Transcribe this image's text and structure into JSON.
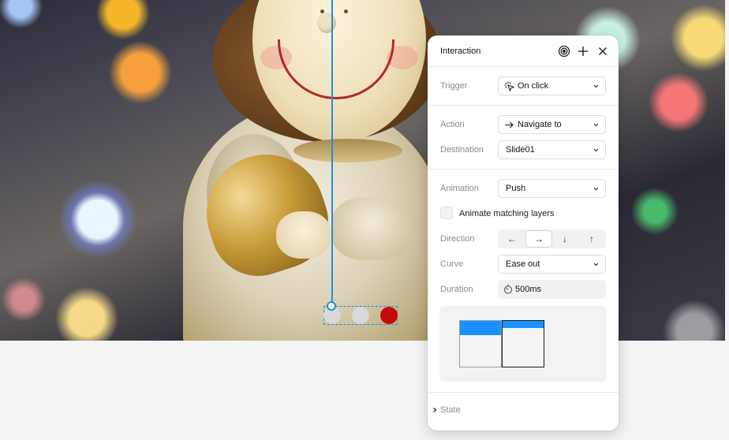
{
  "panel": {
    "title": "Interaction",
    "header_icons": [
      "target-icon",
      "plus-icon",
      "close-icon"
    ]
  },
  "trigger": {
    "label": "Trigger",
    "value": "On click",
    "icon": "click-icon"
  },
  "action": {
    "label": "Action",
    "value": "Navigate to",
    "icon": "arrow-right-icon"
  },
  "destination": {
    "label": "Destination",
    "value": "Slide01"
  },
  "animation": {
    "label": "Animation",
    "value": "Push"
  },
  "animate_matching_layers": {
    "label": "Animate matching layers",
    "checked": false
  },
  "direction": {
    "label": "Direction",
    "options": [
      "←",
      "→",
      "↓",
      "↑"
    ],
    "selected": "→"
  },
  "curve": {
    "label": "Curve",
    "value": "Ease out"
  },
  "duration": {
    "label": "Duration",
    "value": "500ms",
    "icon": "stopwatch-icon"
  },
  "state": {
    "label": "State",
    "expanded": false
  },
  "colors": {
    "accent": "#1d8fe0",
    "preview_bar": "#1992ff",
    "active_dot": "#c40a0a",
    "inactive_dot": "#d9d9d9"
  },
  "canvas": {
    "carousel_dots": [
      {
        "state": "inactive"
      },
      {
        "state": "inactive"
      },
      {
        "state": "active"
      }
    ]
  }
}
